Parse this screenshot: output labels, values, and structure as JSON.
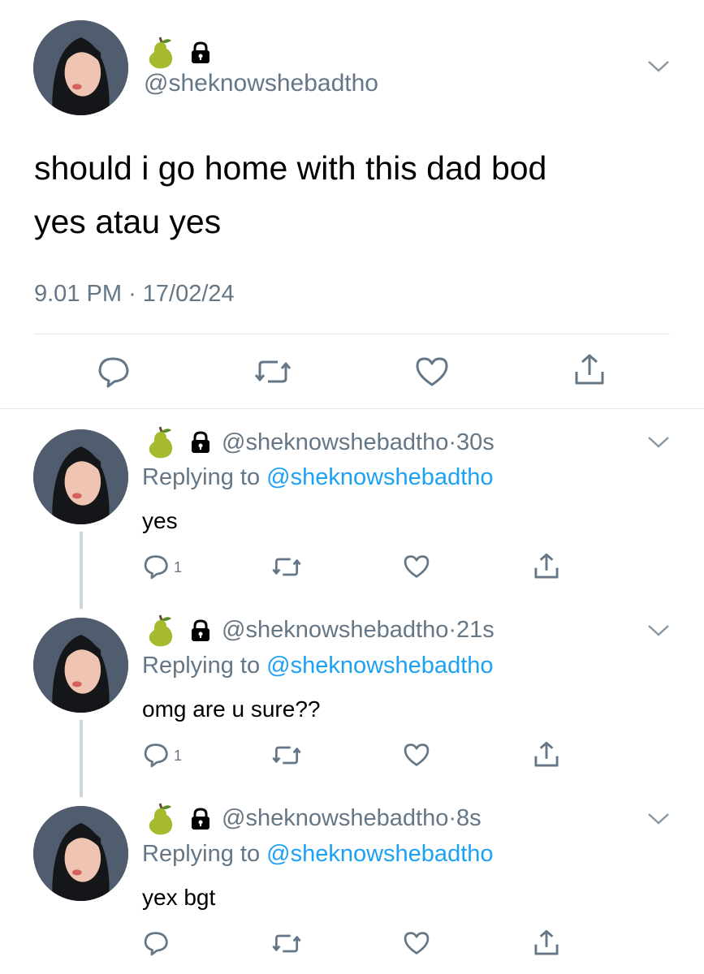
{
  "main_tweet": {
    "handle": "@sheknowshebadtho",
    "name_emoji": "pear-icon",
    "badge": "lock-icon",
    "text_line1": "should i go home with this dad bod",
    "text_line2": "yes atau yes",
    "time": "9.01 PM",
    "separator": "·",
    "date": "17/02/24"
  },
  "replies": [
    {
      "handle": "@sheknowshebadtho",
      "time": "30s",
      "replying_prefix": "Replying to",
      "replying_to": "@sheknowshebadtho",
      "text": "yes",
      "reply_count": "1"
    },
    {
      "handle": "@sheknowshebadtho",
      "time": "21s",
      "replying_prefix": "Replying to",
      "replying_to": "@sheknowshebadtho",
      "text": "omg are u sure??",
      "reply_count": "1"
    },
    {
      "handle": "@sheknowshebadtho",
      "time": "8s",
      "replying_prefix": "Replying to",
      "replying_to": "@sheknowshebadtho",
      "text": "yex bgt",
      "reply_count": ""
    }
  ],
  "colors": {
    "secondary_text": "#657786",
    "link": "#1da1f2",
    "divider": "#e1e8ed",
    "thread_line": "#ccd6dd"
  }
}
